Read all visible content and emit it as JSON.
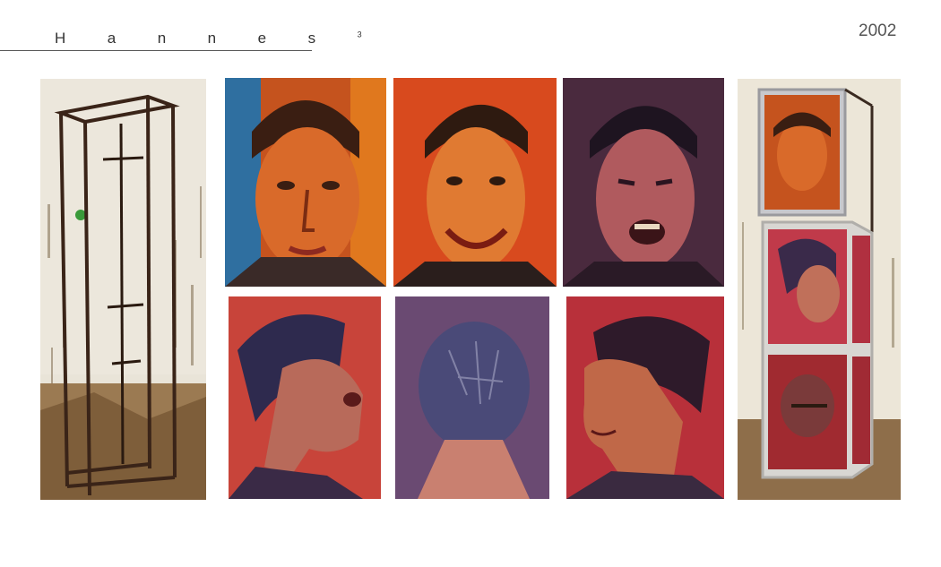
{
  "header": {
    "title": "Hannes",
    "superscript": "3",
    "year": "2002"
  },
  "images": [
    {
      "name": "empty-metal-frame-sculpture"
    },
    {
      "name": "portrait-frontal-blue-orange"
    },
    {
      "name": "portrait-frontal-smiling-red"
    },
    {
      "name": "portrait-frontal-shouting-purple"
    },
    {
      "name": "portrait-profile-left-shouting"
    },
    {
      "name": "portrait-back-of-head"
    },
    {
      "name": "portrait-profile-left-smiling"
    },
    {
      "name": "frame-sculpture-with-paintings"
    }
  ]
}
